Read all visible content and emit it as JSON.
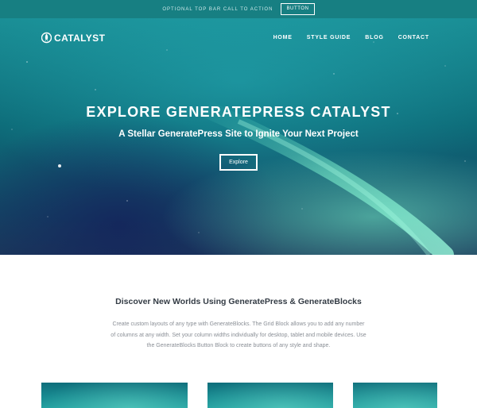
{
  "topbar": {
    "text": "OPTIONAL TOP BAR CALL TO ACTION",
    "button_label": "BUTTON"
  },
  "header": {
    "logo_text": "CATALYST",
    "nav": [
      "HOME",
      "STYLE GUIDE",
      "BLOG",
      "CONTACT"
    ]
  },
  "hero": {
    "title": "EXPLORE GENERATEPRESS CATALYST",
    "subtitle": "A Stellar GeneratePress Site to Ignite Your Next Project",
    "button_label": "Explore"
  },
  "section": {
    "title": "Discover New Worlds Using GeneratePress & GenerateBlocks",
    "body": "Create custom layouts of any type with GenerateBlocks. The Grid Block allows you to add any number of columns at any width. Set your column widths individually for desktop, tablet and mobile devices. Use the GenerateBlocks Button Block to create buttons of any style and shape."
  },
  "colors": {
    "topbar_bg": "#177f82",
    "hero_teal": "#0d6b78",
    "aurora_green": "#78f0c8",
    "heading_text": "#333b44",
    "body_text": "#8a8f96"
  },
  "icons": {
    "logo": "rocket-icon"
  }
}
